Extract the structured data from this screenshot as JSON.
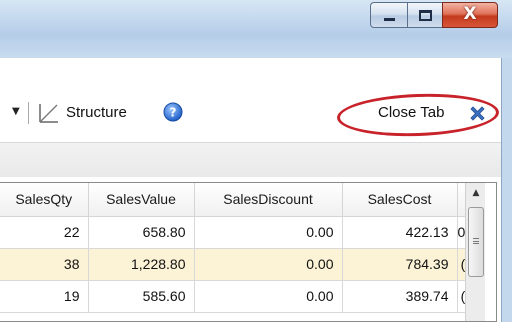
{
  "window": {
    "min_glyph": "minimize-icon",
    "max_glyph": "maximize-icon",
    "close_glyph": "X"
  },
  "toolbar": {
    "structure_label": "Structure",
    "close_tab_label": "Close Tab"
  },
  "icons": {
    "structure": "structure-icon",
    "help": "help-icon",
    "close_tab": "close-x-icon",
    "dropdown": "chevron-down-icon"
  },
  "colors": {
    "highlight_oval": "#c8222a",
    "alt_row": "#fcf3d6",
    "help_blue": "#2e6fd4",
    "close_x_blue": "#3b6fc0"
  },
  "grid": {
    "columns": [
      "SalesQty",
      "SalesValue",
      "SalesDiscount",
      "SalesCost",
      ""
    ],
    "rows": [
      [
        "22",
        "658.80",
        "0.00",
        "422.13",
        "0"
      ],
      [
        "38",
        "1,228.80",
        "0.00",
        "784.39",
        "("
      ],
      [
        "19",
        "585.60",
        "0.00",
        "389.74",
        "("
      ]
    ]
  }
}
